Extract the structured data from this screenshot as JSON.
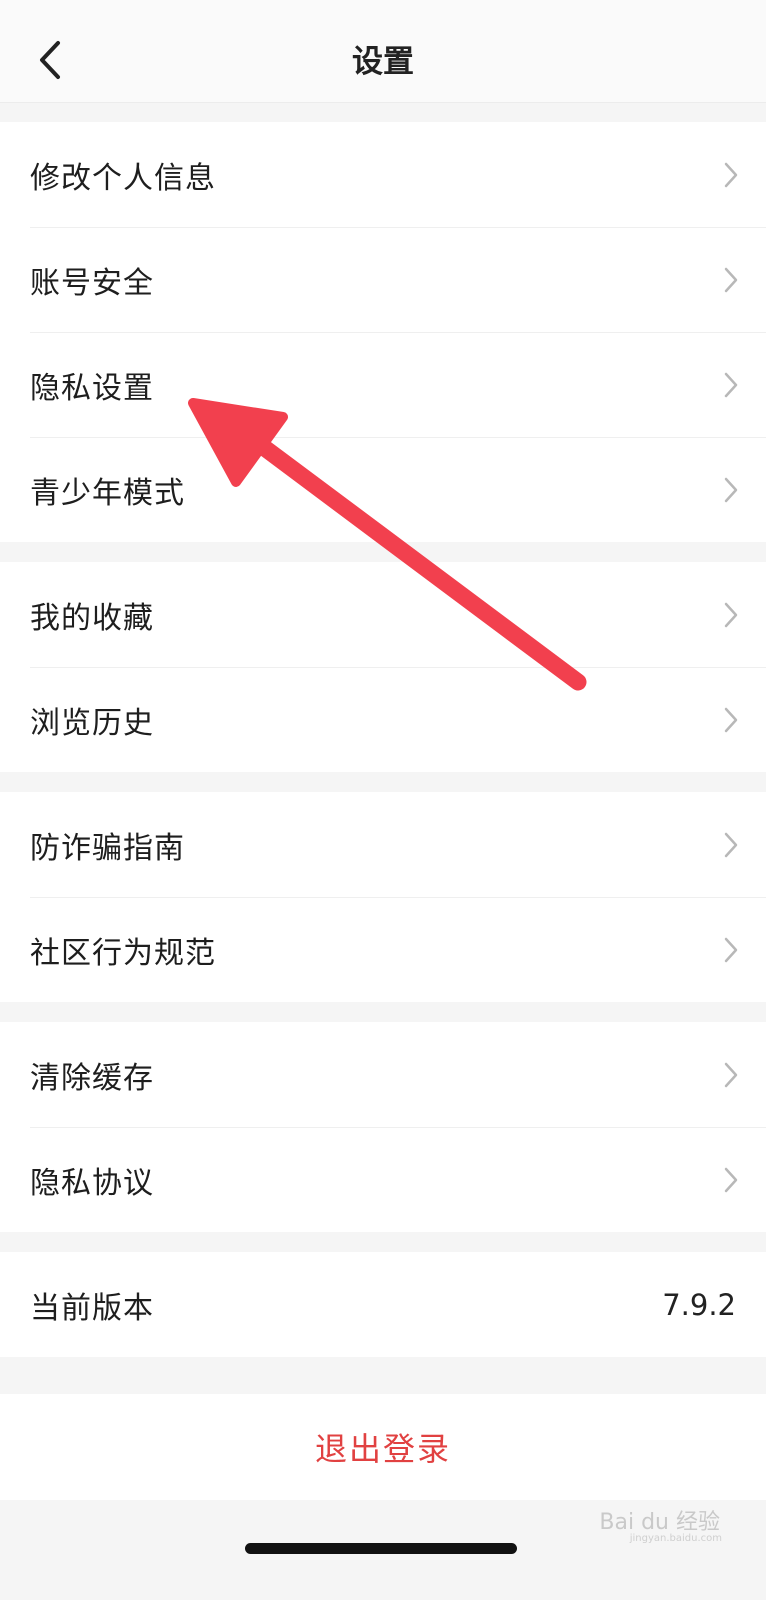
{
  "header": {
    "title": "设置",
    "back_icon": "chevron-left-icon"
  },
  "groups": [
    {
      "items": [
        {
          "label": "修改个人信息"
        },
        {
          "label": "账号安全"
        },
        {
          "label": "隐私设置"
        },
        {
          "label": "青少年模式"
        }
      ]
    },
    {
      "items": [
        {
          "label": "我的收藏"
        },
        {
          "label": "浏览历史"
        }
      ]
    },
    {
      "items": [
        {
          "label": "防诈骗指南"
        },
        {
          "label": "社区行为规范"
        }
      ]
    },
    {
      "items": [
        {
          "label": "清除缓存"
        },
        {
          "label": "隐私协议"
        }
      ]
    },
    {
      "items": [
        {
          "label": "当前版本",
          "value": "7.9.2"
        }
      ]
    }
  ],
  "logout_label": "退出登录",
  "annotation": {
    "type": "arrow",
    "color": "#f2404e"
  },
  "watermark": {
    "text": "Bai du 经验",
    "sub": "jingyan.baidu.com"
  },
  "colors": {
    "background": "#f5f5f5",
    "row_background": "#ffffff",
    "logout_text": "#e14141",
    "chevron": "#b8b8b8"
  }
}
